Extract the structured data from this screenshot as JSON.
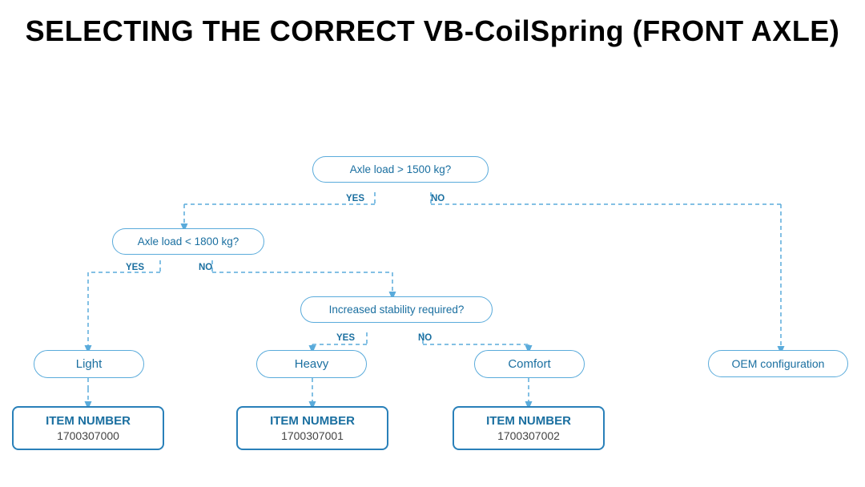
{
  "page": {
    "title": "SELECTING THE CORRECT VB-CoilSpring (FRONT AXLE)"
  },
  "decisions": {
    "axle_load_1500": {
      "label": "Axle load > 1500 kg?",
      "yes": "YES",
      "no": "NO"
    },
    "axle_load_1800": {
      "label": "Axle load < 1800 kg?",
      "yes": "YES",
      "no": "NO"
    },
    "stability": {
      "label": "Increased stability required?",
      "yes": "YES",
      "no": "NO"
    }
  },
  "results": {
    "light": "Light",
    "heavy": "Heavy",
    "comfort": "Comfort",
    "oem": "OEM configuration"
  },
  "items": {
    "item0": {
      "label": "ITEM NUMBER",
      "number": "1700307000"
    },
    "item1": {
      "label": "ITEM NUMBER",
      "number": "1700307001"
    },
    "item2": {
      "label": "ITEM NUMBER",
      "number": "1700307002"
    }
  }
}
